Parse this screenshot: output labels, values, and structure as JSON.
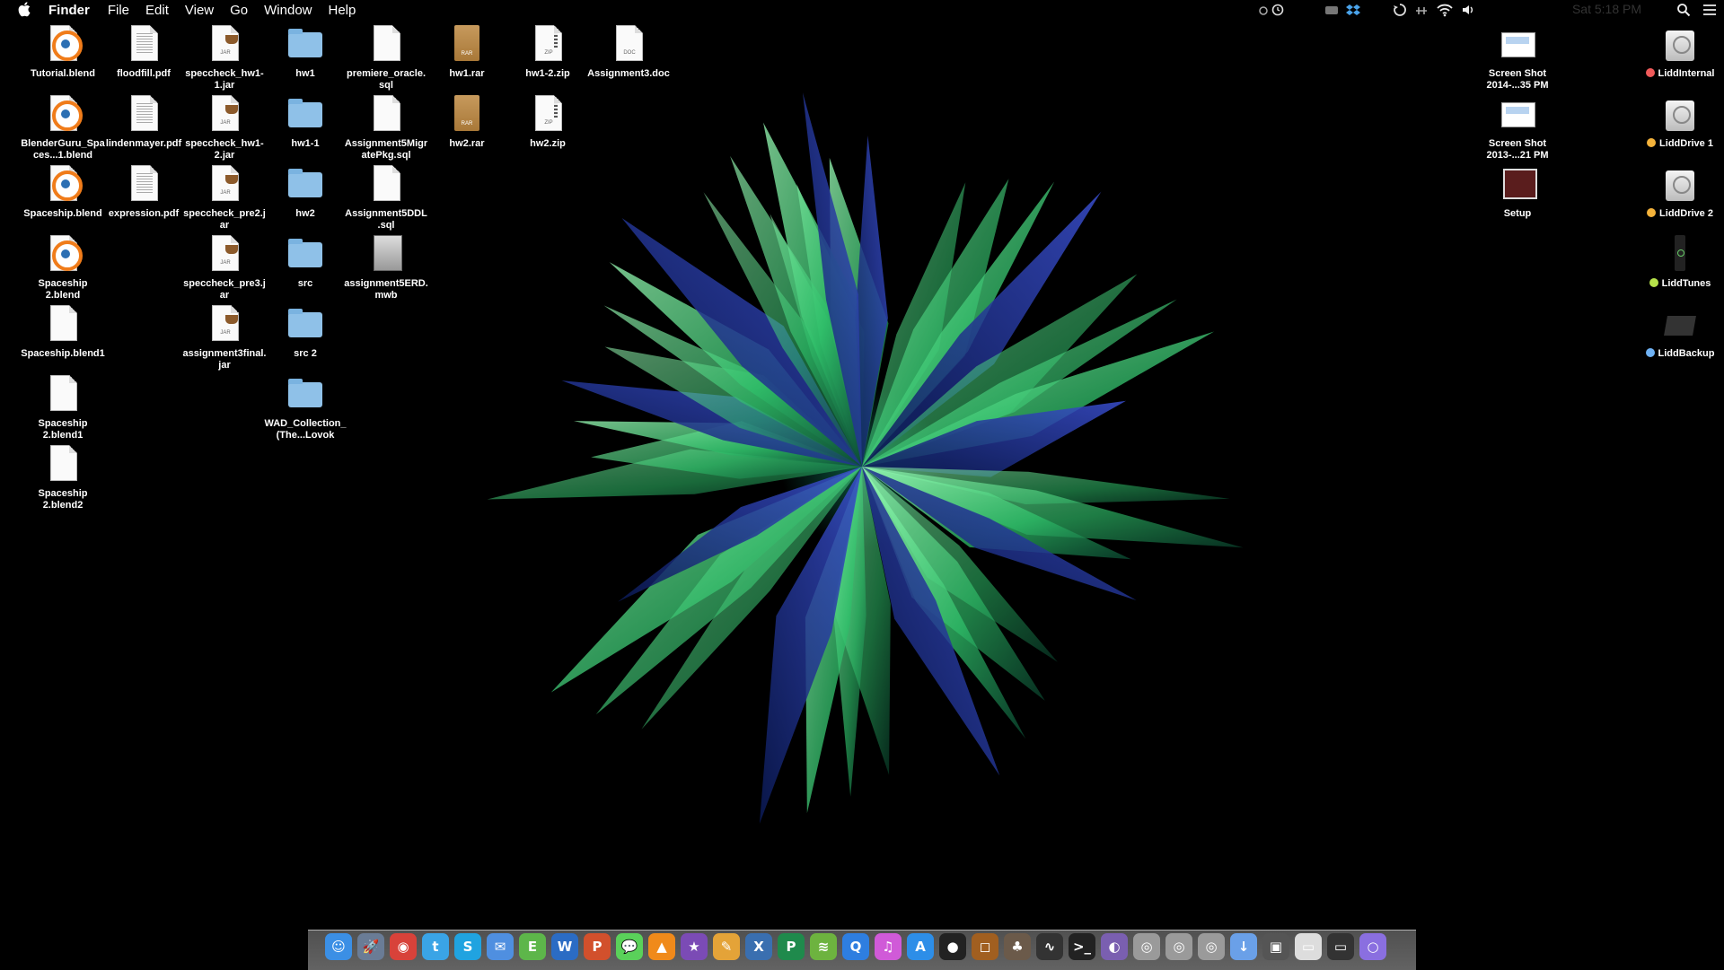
{
  "menubar": {
    "app_name": "Finder",
    "menus": [
      "File",
      "Edit",
      "View",
      "Go",
      "Window",
      "Help"
    ],
    "clock": "Sat 5:18 PM",
    "status_icons": [
      "alarm-icon",
      "mask-icon",
      "dropbox-icon",
      "time-machine-icon",
      "airplay-icon",
      "wifi-icon",
      "volume-icon",
      "spotlight-icon",
      "notification-center-icon"
    ]
  },
  "desktop": {
    "col1": [
      "Tutorial.blend",
      "BlenderGuru_Spaces...1.blend",
      "Spaceship.blend",
      "Spaceship 2.blend",
      "Spaceship.blend1",
      "Spaceship 2.blend1",
      "Spaceship 2.blend2"
    ],
    "col2": [
      "floodfill.pdf",
      "lindenmayer.pdf",
      "expression.pdf"
    ],
    "col3": [
      "speccheck_hw1-1.jar",
      "speccheck_hw1-2.jar",
      "speccheck_pre2.jar",
      "speccheck_pre3.jar",
      "assignment3final.jar"
    ],
    "col4": [
      "hw1",
      "hw1-1",
      "hw2",
      "src",
      "src 2",
      "WAD_Collection_(The...Lovok"
    ],
    "col5": [
      "premiere_oracle.sql",
      "Assignment5MigratePkg.sql",
      "Assignment5DDL.sql",
      "assignment5ERD.mwb"
    ],
    "col6": [
      "hw1.rar",
      "hw2.rar"
    ],
    "col7": [
      "hw1-2.zip",
      "hw2.zip"
    ],
    "col8": [
      "Assignment3.doc"
    ],
    "right1": [
      "Screen Shot 2014-...35 PM",
      "Screen Shot 2013-...21 PM",
      "Setup"
    ],
    "drives": [
      {
        "label": "LiddInternal",
        "tag_color": "#f05a5a"
      },
      {
        "label": "LiddDrive 1",
        "tag_color": "#f5b33b"
      },
      {
        "label": "LiddDrive 2",
        "tag_color": "#f5b33b"
      },
      {
        "label": "LiddTunes",
        "tag_color": "#b6e24a"
      },
      {
        "label": "LiddBackup",
        "tag_color": "#6fb2f5"
      }
    ],
    "file_tags": {
      "jar": "JAR",
      "rar": "RAR",
      "zip": "ZIP",
      "doc": "DOC"
    }
  },
  "dock": {
    "items": [
      {
        "name": "finder-icon",
        "glyph": "☺",
        "color": "#3b8fe5"
      },
      {
        "name": "launchpad-icon",
        "glyph": "🚀",
        "color": "#6a7c96"
      },
      {
        "name": "chrome-icon",
        "glyph": "◉",
        "color": "#d8423a"
      },
      {
        "name": "twitter-icon",
        "glyph": "t",
        "color": "#3aa4e6"
      },
      {
        "name": "skype-icon",
        "glyph": "S",
        "color": "#20a3e0"
      },
      {
        "name": "mail-icon",
        "glyph": "✉",
        "color": "#4f8fe0"
      },
      {
        "name": "evernote-icon",
        "glyph": "E",
        "color": "#5db64a"
      },
      {
        "name": "word-icon",
        "glyph": "W",
        "color": "#2b6cc4"
      },
      {
        "name": "powerpoint-icon",
        "glyph": "P",
        "color": "#d2502c"
      },
      {
        "name": "messages-icon",
        "glyph": "💬",
        "color": "#5ad15a"
      },
      {
        "name": "vlc-icon",
        "glyph": "▲",
        "color": "#f08a1a"
      },
      {
        "name": "imovie-icon",
        "glyph": "★",
        "color": "#7b4bb5"
      },
      {
        "name": "sketch-icon",
        "glyph": "✎",
        "color": "#e4a338"
      },
      {
        "name": "xcode-icon",
        "glyph": "X",
        "color": "#3a6fb0"
      },
      {
        "name": "publisher-icon",
        "glyph": "P",
        "color": "#1f8a4c"
      },
      {
        "name": "spotify-icon",
        "glyph": "≋",
        "color": "#6db33f"
      },
      {
        "name": "quicktime-icon",
        "glyph": "Q",
        "color": "#2e7ee0"
      },
      {
        "name": "itunes-icon",
        "glyph": "♫",
        "color": "#d05ad8"
      },
      {
        "name": "app-store-icon",
        "glyph": "A",
        "color": "#2d8ee8"
      },
      {
        "name": "github-icon",
        "glyph": "●",
        "color": "#222222"
      },
      {
        "name": "sublime-icon",
        "glyph": "◻",
        "color": "#a15f20"
      },
      {
        "name": "blender-app-icon",
        "glyph": "♣",
        "color": "#6b5a4a"
      },
      {
        "name": "activity-monitor-icon",
        "glyph": "∿",
        "color": "#333333"
      },
      {
        "name": "terminal-icon",
        "glyph": ">_",
        "color": "#222222"
      },
      {
        "name": "orb-app-icon",
        "glyph": "◐",
        "color": "#7a5fb0"
      },
      {
        "name": "drive-stack-1-icon",
        "glyph": "◎",
        "color": "#9a9a9a"
      },
      {
        "name": "drive-stack-2-icon",
        "glyph": "◎",
        "color": "#9a9a9a"
      },
      {
        "name": "drive-stack-3-icon",
        "glyph": "◎",
        "color": "#9a9a9a"
      },
      {
        "name": "downloads-stack-icon",
        "glyph": "↓",
        "color": "#6aa0e8"
      },
      {
        "name": "stack-photo-icon",
        "glyph": "▣",
        "color": "#555555"
      },
      {
        "name": "stack-screenshots-icon",
        "glyph": "▭",
        "color": "#dddddd"
      },
      {
        "name": "stack-window-icon",
        "glyph": "▭",
        "color": "#333333"
      },
      {
        "name": "siri-like-icon",
        "glyph": "○",
        "color": "#8a6fe0"
      }
    ]
  }
}
